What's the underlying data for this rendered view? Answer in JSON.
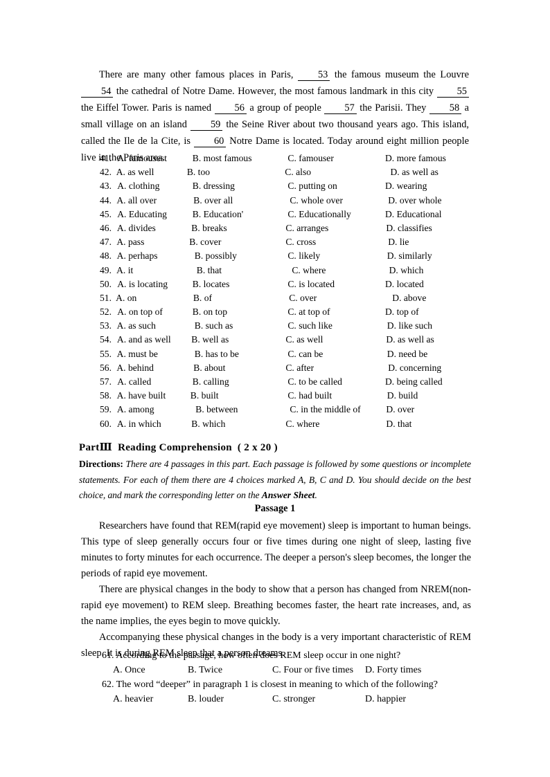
{
  "cloze_passage": {
    "segments": [
      {
        "t": "text",
        "v": "There are many other famous places in Paris, "
      },
      {
        "t": "blank",
        "v": "53"
      },
      {
        "t": "text",
        "v": " the famous museum the Louvre "
      },
      {
        "t": "blank",
        "v": "54"
      },
      {
        "t": "text",
        "v": " the cathedral of Notre Dame. However, the most famous landmark in this city "
      },
      {
        "t": "blank",
        "v": "55"
      },
      {
        "t": "text",
        "v": " the Eiffel Tower. Paris is named "
      },
      {
        "t": "blank",
        "v": "56"
      },
      {
        "t": "text",
        "v": " a group of people "
      },
      {
        "t": "blank",
        "v": "57"
      },
      {
        "t": "text",
        "v": " the Parisii. They "
      },
      {
        "t": "blank",
        "v": "58"
      },
      {
        "t": "text",
        "v": " a small village on an island "
      },
      {
        "t": "blank",
        "v": "59"
      },
      {
        "t": "text",
        "v": " the Seine River about two thousand years ago. This island, called the Ile de la Cite, is "
      },
      {
        "t": "blank",
        "v": "60"
      },
      {
        "t": "text",
        "v": " Notre Dame is located. Today around eight million people live in the Paris area."
      }
    ]
  },
  "cloze_options": [
    {
      "num": "41.",
      "a": "A. famousest",
      "b": "B. most famous",
      "c": "C. famouser",
      "d": "D. more famous"
    },
    {
      "num": "42.",
      "a": "A. as well",
      "b": "B. too",
      "c": "C. also",
      "d": "D. as well as"
    },
    {
      "num": "43.",
      "a": "A. clothing",
      "b": "B. dressing",
      "c": "C. putting on",
      "d": "D. wearing"
    },
    {
      "num": "44.",
      "a": "A. all over",
      "b": "B. over all",
      "c": "C. whole over",
      "d": "D. over whole"
    },
    {
      "num": "45.",
      "a": "A. Educating",
      "b": "B. Education'",
      "c": "C. Educationally",
      "d": "D. Educational"
    },
    {
      "num": "46.",
      "a": "A. divides",
      "b": "B. breaks",
      "c": "C. arranges",
      "d": "D. classifies"
    },
    {
      "num": "47.",
      "a": "A. pass",
      "b": "B. cover",
      "c": "C. cross",
      "d": "D. lie"
    },
    {
      "num": "48.",
      "a": "A. perhaps",
      "b": "B. possibly",
      "c": "C. likely",
      "d": "D. similarly"
    },
    {
      "num": "49.",
      "a": "A. it",
      "b": "B. that",
      "c": "C. where",
      "d": "D. which"
    },
    {
      "num": "50.",
      "a": "A. is locating",
      "b": "B. locates",
      "c": "C. is located",
      "d": "D. located"
    },
    {
      "num": "51.",
      "a": "A. on",
      "b": "B. of",
      "c": "C. over",
      "d": "D. above"
    },
    {
      "num": "52.",
      "a": "A. on top of",
      "b": "B. on top",
      "c": "C. at top of",
      "d": "D. top of"
    },
    {
      "num": "53.",
      "a": "A. as such",
      "b": "B. such as",
      "c": "C. such like",
      "d": "D. like such"
    },
    {
      "num": "54.",
      "a": "A. and as well",
      "b": "B. well as",
      "c": "C. as well",
      "d": "D. as well as"
    },
    {
      "num": "55.",
      "a": "A. must be",
      "b": "B. has to be",
      "c": "C. can be",
      "d": "D. need be"
    },
    {
      "num": "56.",
      "a": "A. behind",
      "b": "B. about",
      "c": "C. after",
      "d": "D. concerning"
    },
    {
      "num": "57.",
      "a": "A. called",
      "b": "B. calling",
      "c": "C. to be called",
      "d": "D. being called"
    },
    {
      "num": "58.",
      "a": "A. have built",
      "b": "B. built",
      "c": "C. had built",
      "d": "D. build"
    },
    {
      "num": "59.",
      "a": "A. among",
      "b": "B. between",
      "c": "C. in the middle of",
      "d": "D. over"
    },
    {
      "num": "60.",
      "a": "A. in which",
      "b": "B. which",
      "c": "C. where",
      "d": "D. that"
    }
  ],
  "part_heading": {
    "part_label": "PartⅢ",
    "title": "Reading Comprehension",
    "score": "( 2 x 20 )"
  },
  "directions": {
    "label": "Directions:",
    "text_before": " There are 4 passages in this part. Each passage is followed by some questions or incomplete statements. For each of them there are 4 choices marked A, B, C and D. You should decide on the best choice,  and mark the corresponding  letter  on the ",
    "emphasis": "Answer Sheet",
    "text_after": "."
  },
  "passage_title": "Passage 1",
  "reading_passage": {
    "paragraphs": [
      "Researchers have found that REM(rapid eye movement) sleep is important to human beings. This type of sleep generally occurs four or five times during one night of sleep, lasting five minutes to forty minutes for each occurrence. The deeper a person's sleep becomes, the longer the periods of rapid eye movement.",
      "There are physical changes in the body to show that a person has changed from NREM(non-rapid eye movement) to REM sleep. Breathing becomes faster, the heart rate increases, and, as the name implies, the eyes begin to move quickly.",
      "Accompanying these physical changes in the body is a very important characteristic of REM sleep. It is during REM sleep that a person dreams."
    ]
  },
  "questions": [
    {
      "stem": "61. According to the passage, how often does REM sleep occur in one night?",
      "a": "A. Once",
      "b": "B. Twice",
      "c": "C. Four or five times",
      "d": "D. Forty times"
    },
    {
      "stem": "62. The word “deeper” in paragraph 1 is closest in meaning to which of the following?",
      "a": "A. heavier",
      "b": "B. louder",
      "c": "C. stronger",
      "d": "D. happier"
    }
  ]
}
